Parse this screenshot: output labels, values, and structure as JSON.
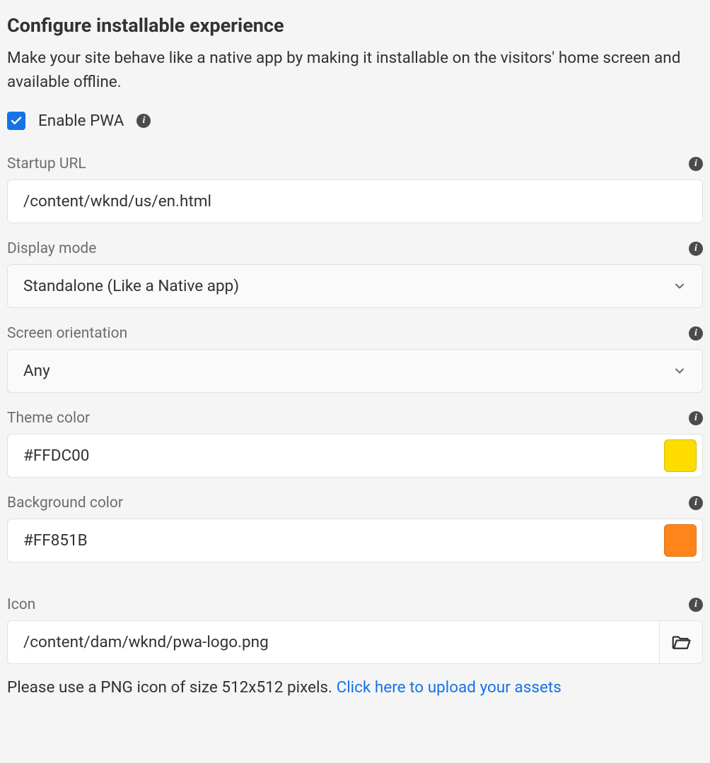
{
  "heading": "Configure installable experience",
  "description": "Make your site behave like a native app by making it installable on the visitors' home screen and available offline.",
  "enable_pwa": {
    "label": "Enable PWA",
    "checked": true
  },
  "fields": {
    "startup_url": {
      "label": "Startup URL",
      "value": "/content/wknd/us/en.html"
    },
    "display_mode": {
      "label": "Display mode",
      "value": "Standalone (Like a Native app)"
    },
    "screen_orientation": {
      "label": "Screen orientation",
      "value": "Any"
    },
    "theme_color": {
      "label": "Theme color",
      "value": "#FFDC00",
      "swatch": "#FFDC00"
    },
    "background_color": {
      "label": "Background color",
      "value": "#FF851B",
      "swatch": "#FF851B"
    },
    "icon": {
      "label": "Icon",
      "value": "/content/dam/wknd/pwa-logo.png"
    }
  },
  "icon_help": {
    "text": "Please use a PNG icon of size 512x512 pixels. ",
    "link_text": "Click here to upload your assets"
  }
}
